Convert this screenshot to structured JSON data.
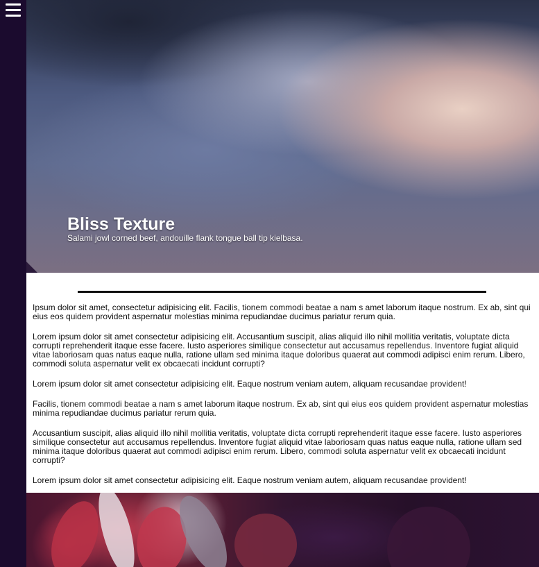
{
  "menu": {
    "icon": "hamburger-menu-icon"
  },
  "hero": {
    "title": "Bliss Texture",
    "subtitle": "Salami jowl corned beef, andouille flank tongue ball tip kielbasa."
  },
  "article": {
    "paragraphs": [
      "Ipsum dolor sit amet, consectetur adipisicing elit. Facilis, tionem commodi beatae a nam s amet laborum itaque nostrum. Ex ab, sint qui eius eos quidem provident aspernatur molestias minima repudiandae ducimus pariatur rerum quia.",
      "Lorem ipsum dolor sit amet consectetur adipisicing elit. Accusantium suscipit, alias aliquid illo nihil mollitia veritatis, voluptate dicta corrupti reprehenderit itaque esse facere. Iusto asperiores similique consectetur aut accusamus repellendus. Inventore fugiat aliquid vitae laboriosam quas natus eaque nulla, ratione ullam sed minima itaque doloribus quaerat aut commodi adipisci enim rerum. Libero, commodi soluta aspernatur velit ex obcaecati incidunt corrupti?",
      "Lorem ipsum dolor sit amet consectetur adipisicing elit. Eaque nostrum veniam autem, aliquam recusandae provident!",
      "Facilis, tionem commodi beatae a nam s amet laborum itaque nostrum. Ex ab, sint qui eius eos quidem provident aspernatur molestias minima repudiandae ducimus pariatur rerum quia.",
      "Accusantium suscipit, alias aliquid illo nihil mollitia veritatis, voluptate dicta corrupti reprehenderit itaque esse facere. Iusto asperiores similique consectetur aut accusamus repellendus. Inventore fugiat aliquid vitae laboriosam quas natus eaque nulla, ratione ullam sed minima itaque doloribus quaerat aut commodi adipisci enim rerum. Libero, commodi soluta aspernatur velit ex obcaecati incidunt corrupti?",
      "Lorem ipsum dolor sit amet consectetur adipisicing elit. Eaque nostrum veniam autem, aliquam recusandae provident!"
    ]
  },
  "colors": {
    "sidebar": "#1b0b2e",
    "content_background": "#ffffff",
    "rule": "#111111"
  }
}
